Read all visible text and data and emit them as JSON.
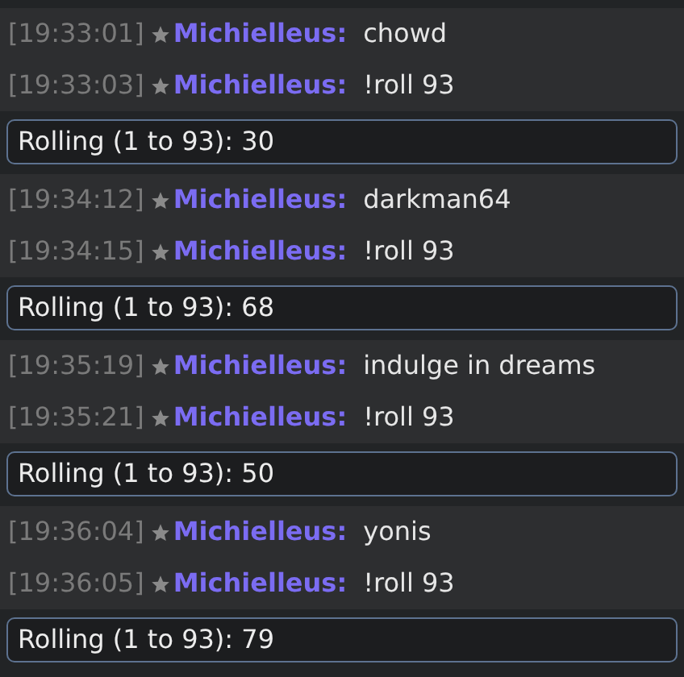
{
  "entries": [
    {
      "kind": "message",
      "time": "[19:33:01]",
      "user": "Michielleus:",
      "text": "chowd"
    },
    {
      "kind": "message",
      "time": "[19:33:03]",
      "user": "Michielleus:",
      "text": "!roll 93"
    },
    {
      "kind": "roll",
      "text": "Rolling (1 to 93): 30"
    },
    {
      "kind": "message",
      "time": "[19:34:12]",
      "user": "Michielleus:",
      "text": "darkman64"
    },
    {
      "kind": "message",
      "time": "[19:34:15]",
      "user": "Michielleus:",
      "text": "!roll 93"
    },
    {
      "kind": "roll",
      "text": "Rolling (1 to 93): 68"
    },
    {
      "kind": "message",
      "time": "[19:35:19]",
      "user": "Michielleus:",
      "text": "indulge in dreams"
    },
    {
      "kind": "message",
      "time": "[19:35:21]",
      "user": "Michielleus:",
      "text": "!roll 93"
    },
    {
      "kind": "roll",
      "text": "Rolling (1 to 93): 50"
    },
    {
      "kind": "message",
      "time": "[19:36:04]",
      "user": "Michielleus:",
      "text": "yonis"
    },
    {
      "kind": "message",
      "time": "[19:36:05]",
      "user": "Michielleus:",
      "text": "!roll 93"
    },
    {
      "kind": "roll",
      "text": "Rolling (1 to 93): 79"
    }
  ]
}
